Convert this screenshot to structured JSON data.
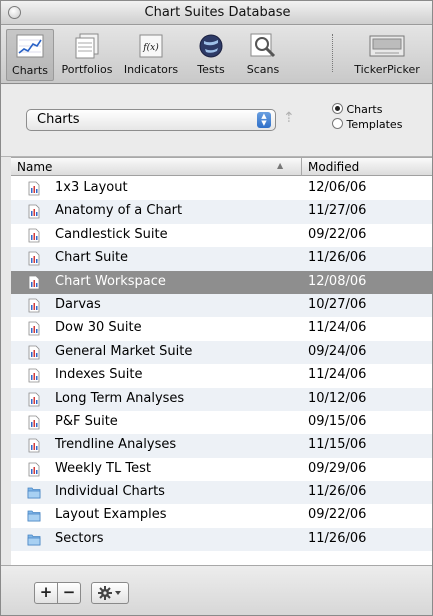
{
  "window": {
    "title": "Chart Suites Database"
  },
  "toolbar": {
    "items": [
      {
        "label": "Charts",
        "icon": "chart-icon"
      },
      {
        "label": "Portfolios",
        "icon": "portfolio-icon"
      },
      {
        "label": "Indicators",
        "icon": "function-icon"
      },
      {
        "label": "Tests",
        "icon": "globe-icon"
      },
      {
        "label": "Scans",
        "icon": "magnifier-icon"
      },
      {
        "label": "TickerPicker",
        "icon": "ticker-picker-icon"
      }
    ],
    "indicators_glyph": "f(x)"
  },
  "selector": {
    "popup_value": "Charts",
    "radio_options": [
      {
        "label": "Charts",
        "selected": true
      },
      {
        "label": "Templates",
        "selected": false
      }
    ]
  },
  "table": {
    "columns": {
      "name": "Name",
      "modified": "Modified"
    },
    "rows": [
      {
        "name": "1x3 Layout",
        "modified": "12/06/06",
        "type": "chart"
      },
      {
        "name": "Anatomy of a Chart",
        "modified": "11/27/06",
        "type": "chart"
      },
      {
        "name": "Candlestick Suite",
        "modified": "09/22/06",
        "type": "chart"
      },
      {
        "name": "Chart Suite",
        "modified": "11/26/06",
        "type": "chart"
      },
      {
        "name": "Chart Workspace",
        "modified": "12/08/06",
        "type": "chart",
        "selected": true
      },
      {
        "name": "Darvas",
        "modified": "10/27/06",
        "type": "chart"
      },
      {
        "name": "Dow 30 Suite",
        "modified": "11/24/06",
        "type": "chart"
      },
      {
        "name": "General Market Suite",
        "modified": "09/24/06",
        "type": "chart"
      },
      {
        "name": "Indexes Suite",
        "modified": "11/24/06",
        "type": "chart"
      },
      {
        "name": "Long Term Analyses",
        "modified": "10/12/06",
        "type": "chart"
      },
      {
        "name": "P&F Suite",
        "modified": "09/15/06",
        "type": "chart"
      },
      {
        "name": "Trendline Analyses",
        "modified": "11/15/06",
        "type": "chart"
      },
      {
        "name": "Weekly TL Test",
        "modified": "09/29/06",
        "type": "chart"
      },
      {
        "name": "Individual Charts",
        "modified": "11/26/06",
        "type": "folder"
      },
      {
        "name": "Layout Examples",
        "modified": "09/22/06",
        "type": "folder"
      },
      {
        "name": "Sectors",
        "modified": "11/26/06",
        "type": "folder"
      }
    ]
  },
  "bottom_bar": {
    "add_label": "+",
    "remove_label": "−",
    "action_icon": "gear-icon"
  },
  "colors": {
    "selected_row": "#8e8e8e",
    "alt_row": "#edf1f6",
    "folder": "#7fb6e8"
  }
}
